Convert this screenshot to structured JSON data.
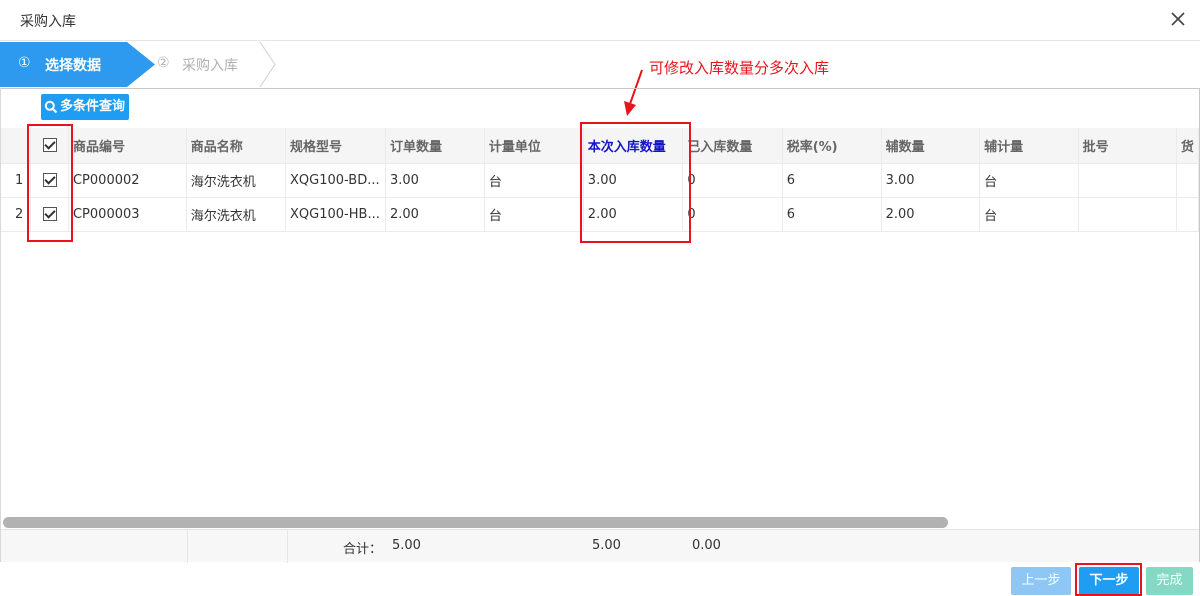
{
  "window": {
    "title": "采购入库",
    "close_icon": "close-icon"
  },
  "steps": [
    {
      "num": "①",
      "label": "选择数据",
      "active": true
    },
    {
      "num": "②",
      "label": "采购入库",
      "active": false
    }
  ],
  "annotation": "可修改入库数量分多次入库",
  "toolbar": {
    "query_label": "多条件查询",
    "query_icon": "search-icon"
  },
  "grid": {
    "columns": [
      "商品编号",
      "商品名称",
      "规格型号",
      "订单数量",
      "计量单位",
      "本次入库数量",
      "已入库数量",
      "税率(%)",
      "辅数量",
      "辅计量",
      "批号",
      "货"
    ],
    "rows": [
      {
        "num": "1",
        "checked": true,
        "cells": [
          "CP000002",
          "海尔洗衣机",
          "XQG100-BD...",
          "3.00",
          "台",
          "3.00",
          "0",
          "6",
          "3.00",
          "台",
          "",
          ""
        ]
      },
      {
        "num": "2",
        "checked": true,
        "cells": [
          "CP000003",
          "海尔洗衣机",
          "XQG100-HB...",
          "2.00",
          "台",
          "2.00",
          "0",
          "6",
          "2.00",
          "台",
          "",
          ""
        ]
      }
    ],
    "footer": {
      "label": "合计：",
      "order_total": "5.00",
      "this_total": "5.00",
      "received_total": "0.00"
    }
  },
  "buttons": {
    "prev": "上一步",
    "next": "下一步",
    "done": "完成"
  },
  "colors": {
    "accent": "#1e9df2",
    "highlight": "#e8141c",
    "header_highlight": "#1515c8"
  }
}
